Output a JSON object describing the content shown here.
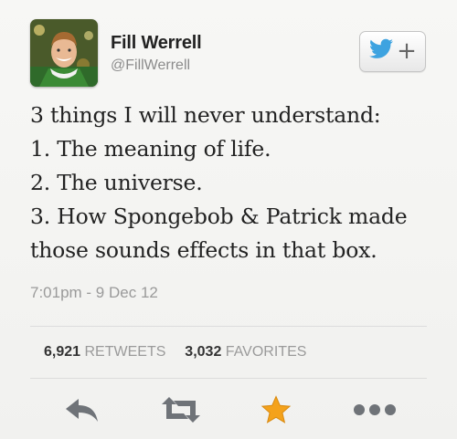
{
  "user": {
    "display_name": "Fill Werrell",
    "handle": "@FillWerrell"
  },
  "tweet": {
    "lines": [
      "3 things I will never understand:",
      "1. The meaning of life.",
      "2. The universe.",
      "3. How Spongebob & Patrick made",
      "those sounds effects in that box."
    ],
    "timestamp": "7:01pm - 9 Dec 12"
  },
  "stats": {
    "retweets_count": "6,921",
    "retweets_label": "RETWEETS",
    "favorites_count": "3,032",
    "favorites_label": "FAVORITES"
  },
  "actions": [
    {
      "icon": "reply-icon"
    },
    {
      "icon": "retweet-icon"
    },
    {
      "icon": "favorite-star-icon"
    },
    {
      "icon": "more-options-icon"
    }
  ],
  "follow_button": {
    "icons": [
      "twitter-bird-icon",
      "plus-icon"
    ],
    "plus_glyph": "+"
  },
  "colors": {
    "twitter_blue": "#3ea3e0",
    "favorite_orange": "#f4a21b",
    "icon_gray": "#6f7378",
    "muted_text": "#9a9a9a"
  }
}
